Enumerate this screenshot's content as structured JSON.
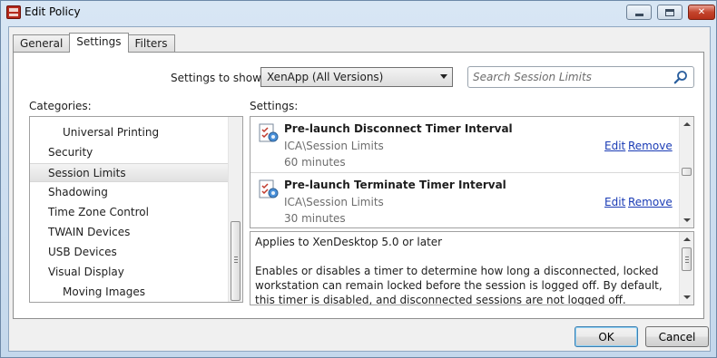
{
  "window": {
    "title": "Edit Policy",
    "controls": {
      "minimize": "",
      "maximize": "",
      "close": "✕"
    }
  },
  "tabs": [
    {
      "label": "General",
      "active": false
    },
    {
      "label": "Settings",
      "active": true
    },
    {
      "label": "Filters",
      "active": false
    }
  ],
  "toolbar": {
    "settings_to_show_label": "Settings to show:",
    "settings_to_show_value": "XenApp (All Versions)",
    "search_placeholder": "Search Session Limits"
  },
  "categories": {
    "label": "Categories:",
    "items": [
      {
        "label": "Universal Printing",
        "indent": true,
        "selected": false
      },
      {
        "label": "Security",
        "indent": false,
        "selected": false
      },
      {
        "label": "Session Limits",
        "indent": false,
        "selected": true
      },
      {
        "label": "Shadowing",
        "indent": false,
        "selected": false
      },
      {
        "label": "Time Zone Control",
        "indent": false,
        "selected": false
      },
      {
        "label": "TWAIN Devices",
        "indent": false,
        "selected": false
      },
      {
        "label": "USB Devices",
        "indent": false,
        "selected": false
      },
      {
        "label": "Visual Display",
        "indent": false,
        "selected": false
      },
      {
        "label": "Moving Images",
        "indent": true,
        "selected": false
      }
    ]
  },
  "settings": {
    "label": "Settings:",
    "items": [
      {
        "title": "Pre-launch Disconnect Timer Interval",
        "path": "ICA\\Session Limits",
        "value": "60 minutes",
        "edit_label": "Edit",
        "remove_label": "Remove"
      },
      {
        "title": "Pre-launch Terminate Timer Interval",
        "path": "ICA\\Session Limits",
        "value": "30 minutes",
        "edit_label": "Edit",
        "remove_label": "Remove"
      }
    ]
  },
  "description": {
    "applies_to": "Applies to XenDesktop 5.0 or later",
    "body": "Enables or disables a timer to determine how long a disconnected, locked workstation can remain locked before the session is logged off. By default, this timer is disabled, and disconnected sessions are not logged off."
  },
  "buttons": {
    "ok": "OK",
    "cancel": "Cancel"
  },
  "colors": {
    "link": "#1a3bb5",
    "close_button": "#c4442c",
    "default_button_border": "#3c7fb1"
  }
}
